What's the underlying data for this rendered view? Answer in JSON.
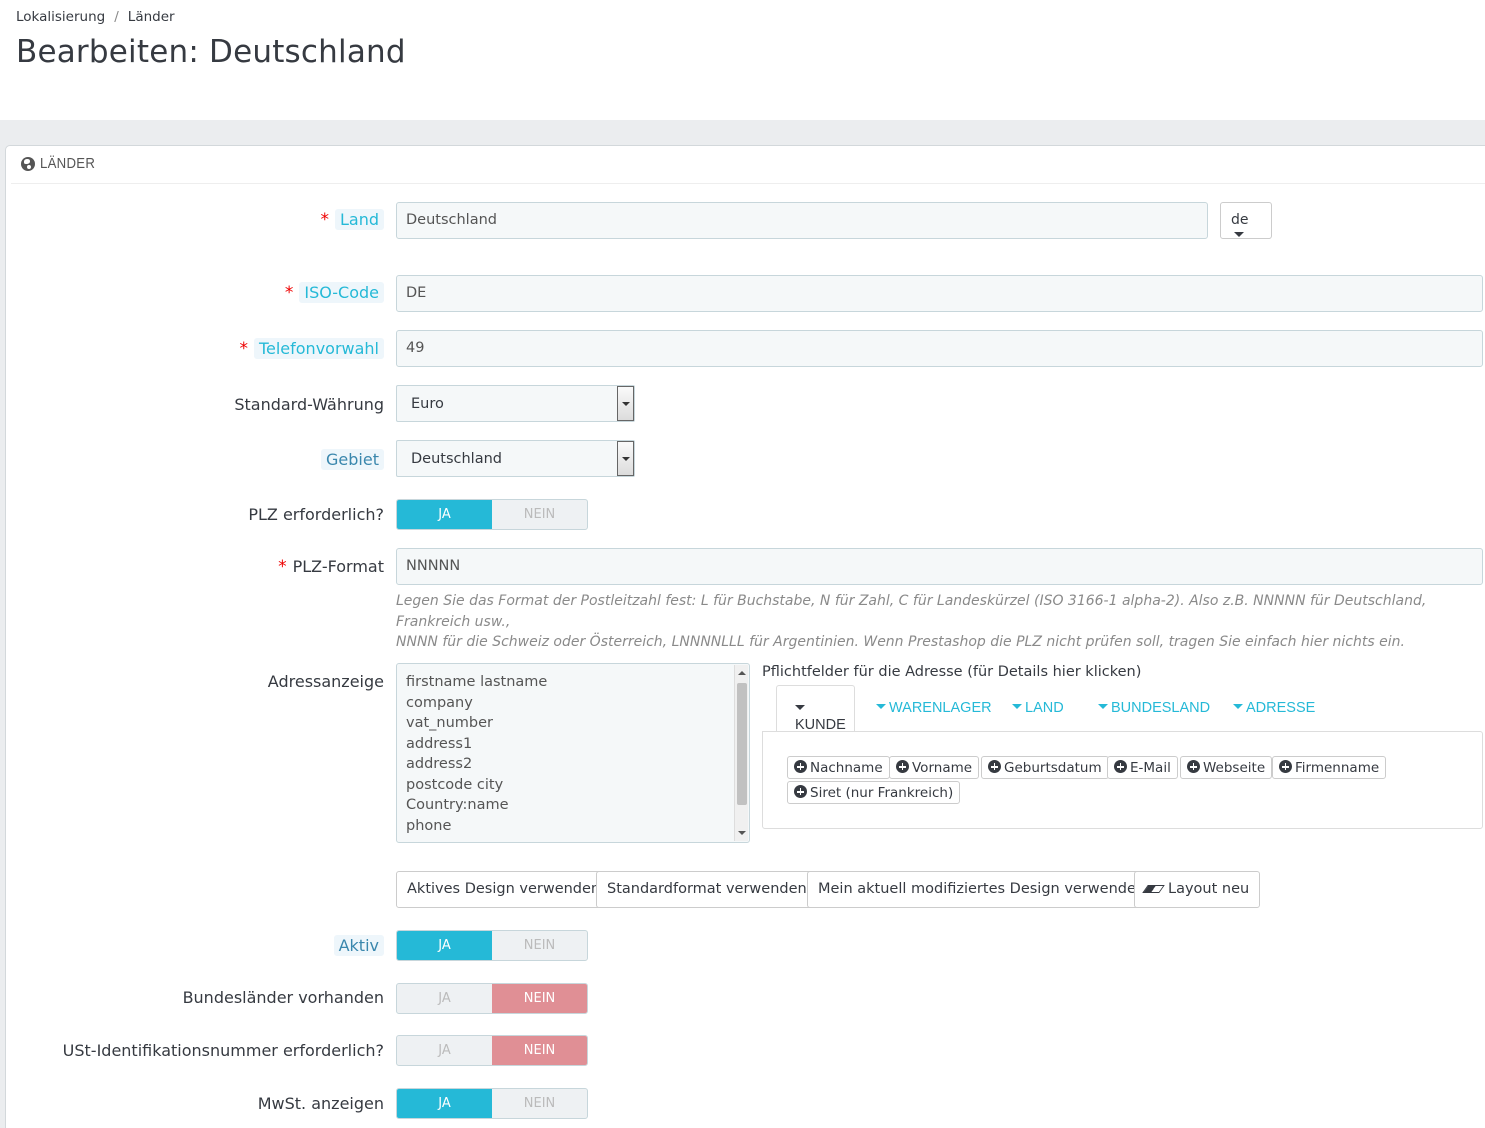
{
  "breadcrumb": {
    "parent": "Lokalisierung",
    "separator": "/",
    "current": "Länder"
  },
  "page": {
    "title": "Bearbeiten: Deutschland"
  },
  "panel": {
    "heading": "LÄNDER",
    "heading_icon": "globe-icon"
  },
  "fields": {
    "land": {
      "label": "Land",
      "required": true,
      "value": "Deutschland",
      "lang": "de"
    },
    "iso": {
      "label": "ISO-Code",
      "required": true,
      "value": "DE"
    },
    "phone": {
      "label": "Telefonvorwahl",
      "required": true,
      "value": "49"
    },
    "currency": {
      "label": "Standard-Währung",
      "value": "Euro"
    },
    "zone": {
      "label": "Gebiet",
      "value": "Deutschland"
    },
    "zip_required": {
      "label": "PLZ erforderlich?",
      "value": "JA"
    },
    "zip_format": {
      "label": "PLZ-Format",
      "required": true,
      "value": "NNNNN",
      "help_line1": "Legen Sie das Format der Postleitzahl fest: L für Buchstabe, N für Zahl, C für Landeskürzel (ISO 3166-1 alpha-2). Also z.B. NNNNN für Deutschland, Frankreich usw.,",
      "help_line2": "NNNN für die Schweiz oder Österreich, LNNNNLLL für Argentinien. Wenn Prestashop die PLZ nicht prüfen soll, tragen Sie einfach hier nichts ein."
    },
    "address_layout": {
      "label": "Adressanzeige",
      "lines": [
        "firstname lastname",
        "company",
        "vat_number",
        "address1",
        "address2",
        "postcode city",
        "Country:name",
        "phone"
      ]
    },
    "active": {
      "label": "Aktiv",
      "value": "JA"
    },
    "states": {
      "label": "Bundesländer vorhanden",
      "value": "NEIN"
    },
    "vat_required": {
      "label": "USt-Identifikationsnummer erforderlich?",
      "value": "NEIN"
    },
    "show_tax": {
      "label": "MwSt. anzeigen",
      "value": "JA"
    }
  },
  "switch_labels": {
    "yes": "JA",
    "no": "NEIN"
  },
  "required_fields": {
    "title": "Pflichtfelder für die Adresse (für Details hier klicken)",
    "tabs": [
      "KUNDE",
      "WARENLAGER",
      "LAND",
      "BUNDESLAND",
      "ADRESSE"
    ],
    "active_tab": "KUNDE",
    "chips": [
      "Nachname",
      "Vorname",
      "Geburtsdatum",
      "E-Mail",
      "Webseite",
      "Firmenname",
      "Siret (nur Frankreich)"
    ]
  },
  "layout_buttons": {
    "active_design": "Aktives Design verwenden",
    "default_format": "Standardformat verwenden",
    "modified_design": "Mein aktuell modifiziertes Design verwenden",
    "reset": "Layout neu"
  },
  "colors": {
    "accent": "#25b9d7",
    "danger_switch": "#e08f95",
    "required": "#ee0000"
  }
}
